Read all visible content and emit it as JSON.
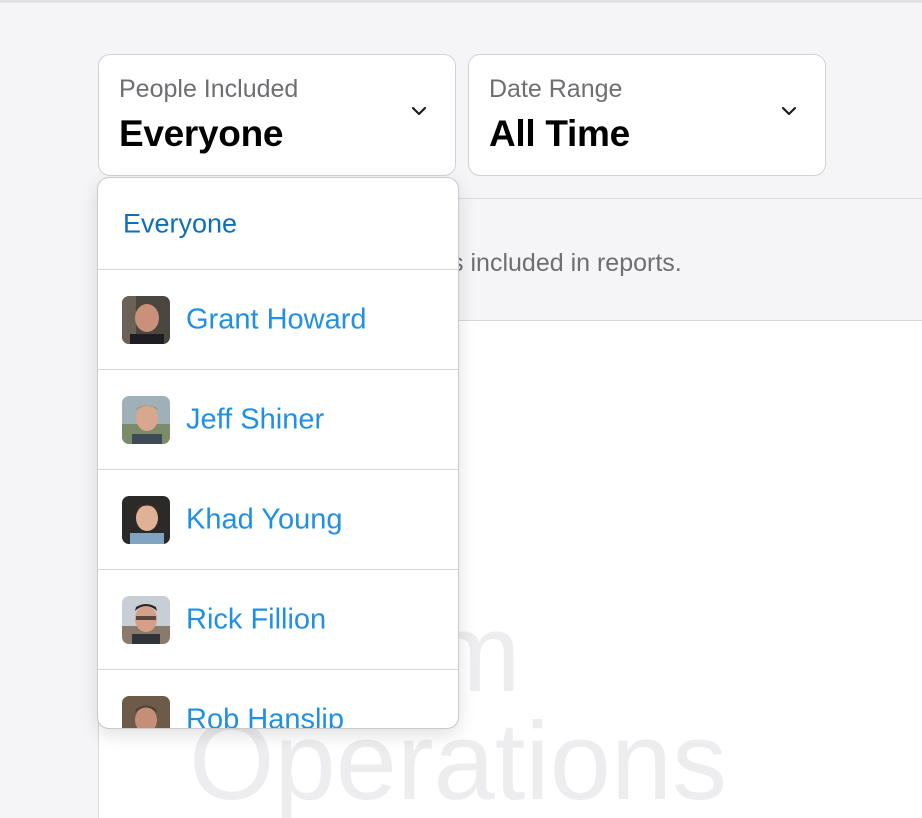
{
  "filters": {
    "people": {
      "label": "People Included",
      "value": "Everyone"
    },
    "date": {
      "label": "Date Range",
      "value": "All Time"
    }
  },
  "background": {
    "description": "t’s included in reports.",
    "ghost_line1": "m",
    "ghost_line2": "Operations"
  },
  "dropdown": {
    "options": [
      {
        "label": "Everyone"
      },
      {
        "label": "Grant Howard",
        "avatar": "avatar-photo"
      },
      {
        "label": "Jeff Shiner",
        "avatar": "avatar-photo"
      },
      {
        "label": "Khad Young",
        "avatar": "avatar-photo"
      },
      {
        "label": "Rick Fillion",
        "avatar": "avatar-photo"
      },
      {
        "label": "Rob Hanslip",
        "avatar": "avatar-photo"
      }
    ]
  },
  "colors": {
    "accent": "#2090e6",
    "selected": "#0e6fb8",
    "label_gray": "#6e6e73"
  }
}
